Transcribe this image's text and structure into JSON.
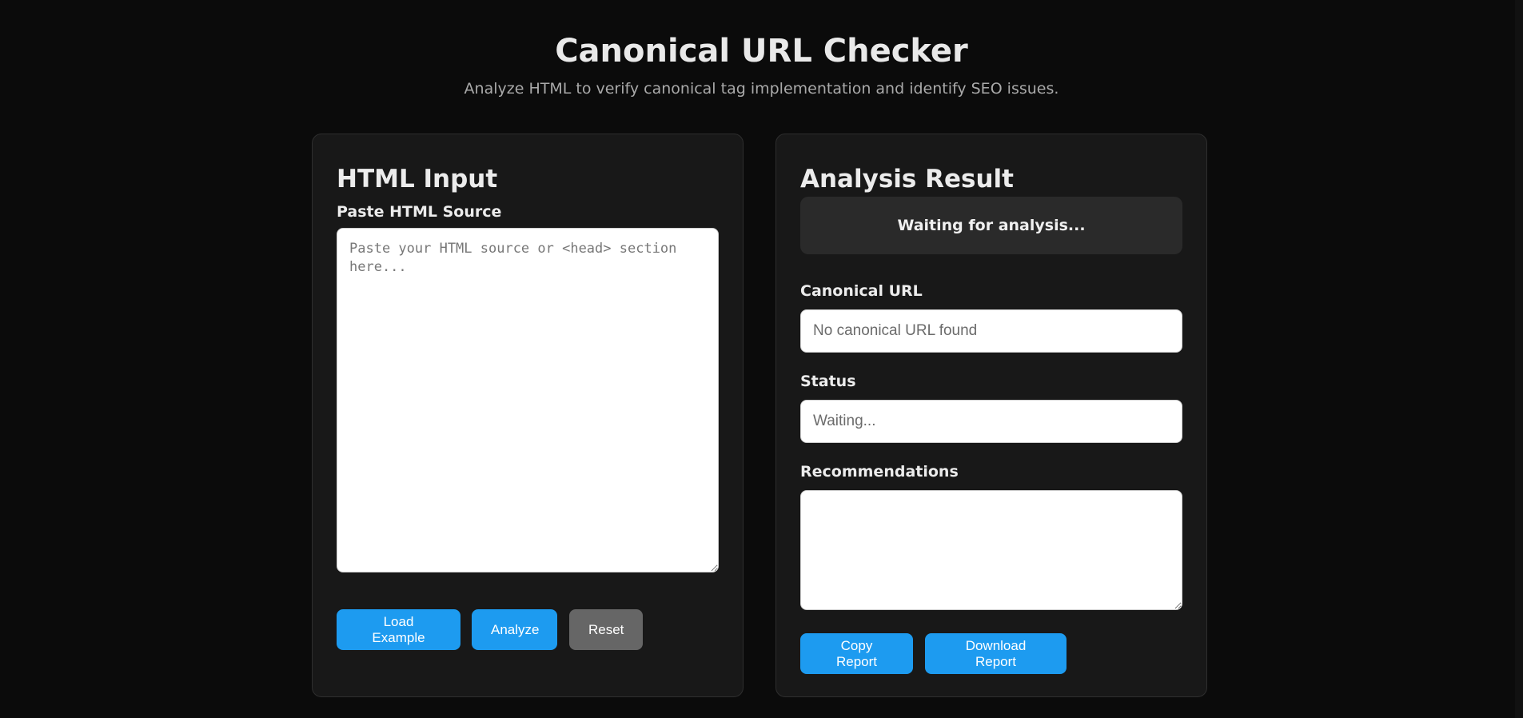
{
  "header": {
    "title": "Canonical URL Checker",
    "subtitle": "Analyze HTML to verify canonical tag implementation and identify SEO issues."
  },
  "input_panel": {
    "heading": "HTML Input",
    "source_label": "Paste HTML Source",
    "source_value": "",
    "source_placeholder": "Paste your HTML source or <head> section here...",
    "buttons": {
      "load_example": "Load Example",
      "analyze": "Analyze",
      "reset": "Reset"
    }
  },
  "result_panel": {
    "heading": "Analysis Result",
    "status_message": "Waiting for analysis...",
    "canonical_label": "Canonical URL",
    "canonical_value": "",
    "canonical_placeholder": "No canonical URL found",
    "status_label": "Status",
    "status_value": "",
    "status_placeholder": "Waiting...",
    "recommendations_label": "Recommendations",
    "recommendations_value": "",
    "buttons": {
      "copy_report": "Copy Report",
      "download_report": "Download Report"
    }
  },
  "colors": {
    "background": "#0b0b0b",
    "card": "#181818",
    "primary_button": "#1d9bf0",
    "secondary_button": "#666666"
  }
}
